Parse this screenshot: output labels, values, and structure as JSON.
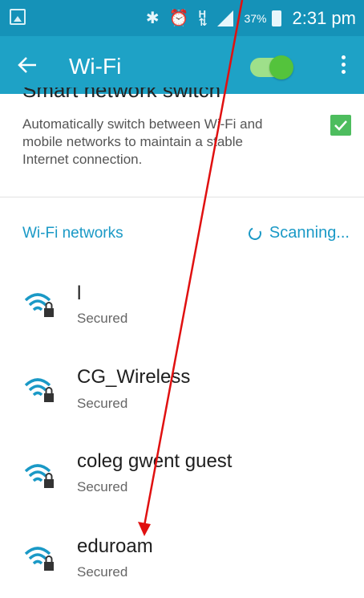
{
  "status_bar": {
    "battery_percent": "37%",
    "time": "2:31 pm",
    "icons": [
      "image-icon",
      "bluetooth-icon",
      "alarm-icon",
      "hspa-icon",
      "signal-icon",
      "battery-icon"
    ]
  },
  "app_bar": {
    "title": "Wi-Fi",
    "wifi_enabled": true
  },
  "smart_switch": {
    "title": "Smart network switch",
    "description": "Automatically switch between Wi-Fi and mobile networks to maintain a stable Internet connection.",
    "checked": true
  },
  "networks": {
    "header": "Wi-Fi networks",
    "scanning": "Scanning...",
    "items": [
      {
        "name": "l",
        "status": "Secured"
      },
      {
        "name": "CG_Wireless",
        "status": "Secured"
      },
      {
        "name": "coleg gwent guest",
        "status": "Secured"
      },
      {
        "name": "eduroam",
        "status": "Secured"
      }
    ]
  },
  "colors": {
    "status_bar": "#1592b8",
    "app_bar": "#1ea2c6",
    "accent": "#1a99c6",
    "toggle_on": "#54c33c",
    "annotation_arrow": "#e01010"
  }
}
